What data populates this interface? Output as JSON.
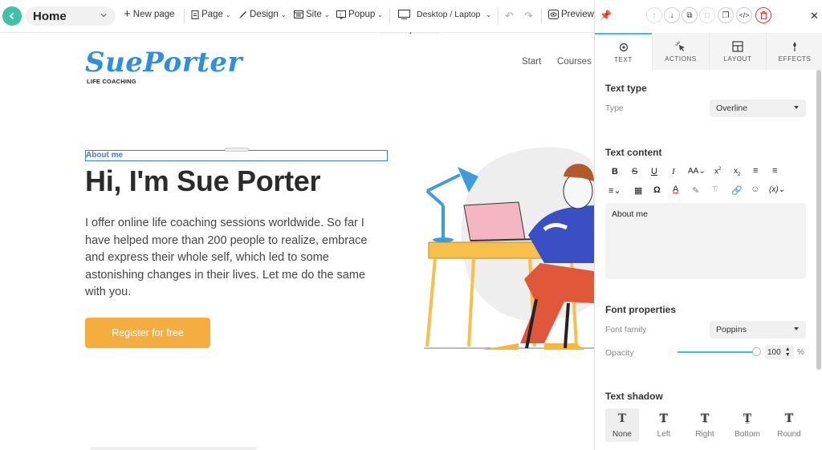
{
  "toolbar": {
    "page_name": "Home",
    "new_page": "New page",
    "page": "Page",
    "design": "Design",
    "site": "Site",
    "popup": "Popup",
    "device": "Desktop / Laptop",
    "preview": "Preview"
  },
  "site": {
    "logo": "SuePorter",
    "logo_sub": "LIFE COACHING",
    "nav": [
      "Start",
      "Courses"
    ],
    "overline": "About me",
    "title": "Hi, I'm Sue Porter",
    "body_lines": [
      "I offer online life coaching sessions worldwide. So far I",
      "have helped more than 200 people to realize, embrace",
      "and express their whole self, which led to some",
      "astonishing changes in their lives. Let me do the same",
      "with you."
    ],
    "cta": "Register for free"
  },
  "panel": {
    "tabs": [
      "TEXT",
      "ACTIONS",
      "LAYOUT",
      "EFFECTS"
    ],
    "text_type_heading": "Text type",
    "type_label": "Type",
    "type_value": "Overline",
    "text_content_heading": "Text content",
    "content_value": "About me",
    "font_props_heading": "Font properties",
    "font_family_label": "Font family",
    "font_family_value": "Poppins",
    "opacity_label": "Opacity",
    "opacity_value": "100",
    "opacity_unit": "%",
    "text_shadow_heading": "Text shadow",
    "shadow_options": [
      "None",
      "Left",
      "Right",
      "Bottom",
      "Round"
    ]
  },
  "colors": {
    "accent_teal": "#3fc1c9",
    "brand_blue": "#2f8fdc",
    "cta_orange": "#f6ad3f",
    "delete_red": "#e03c3c"
  }
}
